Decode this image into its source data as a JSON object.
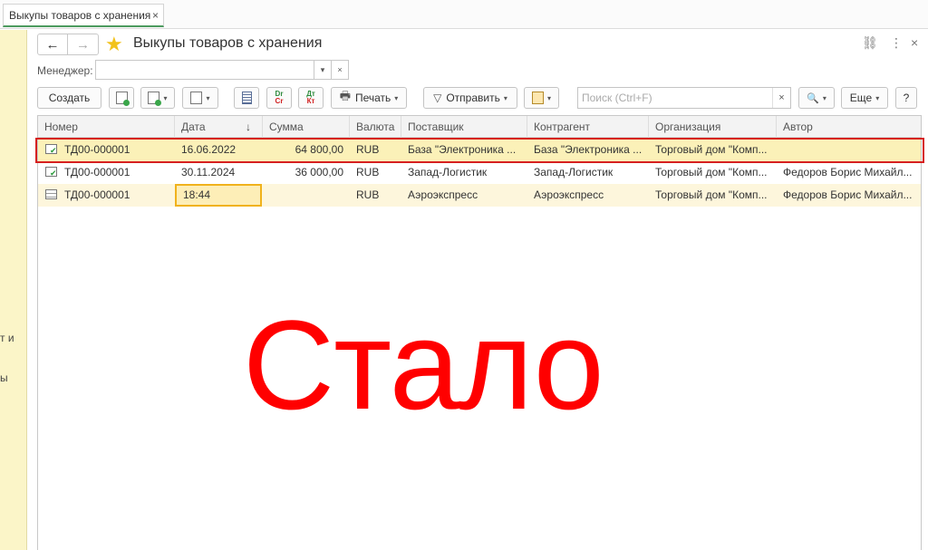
{
  "tab": {
    "label": "Выкупы товаров с хранения",
    "close": "×"
  },
  "left_panel": {
    "lines": [
      "т и",
      "ы"
    ]
  },
  "header": {
    "title": "Выкупы товаров с хранения",
    "back": "←",
    "forward": "→",
    "favorite": "★",
    "link_icon": "⛓",
    "more_icon": "⋮",
    "close_icon": "×"
  },
  "filter": {
    "label": "Менеджер:",
    "value": "",
    "dropdown": "▾",
    "clear": "×"
  },
  "toolbar": {
    "create_label": "Создать",
    "print_label": "Печать",
    "send_label": "Отправить",
    "more_label": "Еще",
    "help_label": "?",
    "search_placeholder": "Поиск (Ctrl+F)",
    "search_clear": "×",
    "search_icon": "🔍",
    "caret": "▾"
  },
  "table": {
    "columns": [
      "Номер",
      "Дата",
      "Сумма",
      "Валюта",
      "Поставщик",
      "Контрагент",
      "Организация",
      "Автор"
    ],
    "sort_indicator": "↓",
    "rows": [
      {
        "number": "ТД00-000001",
        "date": "16.06.2022",
        "sum": "64 800,00",
        "currency": "RUB",
        "supplier": "База \"Электроника ...",
        "counterparty": "База \"Электроника ...",
        "organization": "Торговый дом \"Комп...",
        "author": "",
        "status": "posted"
      },
      {
        "number": "ТД00-000001",
        "date": "30.11.2024",
        "sum": "36 000,00",
        "currency": "RUB",
        "supplier": "Запад-Логистик",
        "counterparty": "Запад-Логистик",
        "organization": "Торговый дом \"Комп...",
        "author": "Федоров Борис Михайл...",
        "status": "posted"
      },
      {
        "number": "ТД00-000001",
        "date": "18:44",
        "sum": "",
        "currency": "RUB",
        "supplier": "Аэроэкспресс",
        "counterparty": "Аэроэкспресс",
        "organization": "Торговый дом \"Комп...",
        "author": "Федоров Борис Михайл...",
        "status": "draft"
      }
    ]
  },
  "overlay_text": "Стало",
  "colors": {
    "accent_green": "#4d9b5f",
    "selection_red": "#d62020",
    "overlay_red": "#ff0000",
    "row_highlight": "#fbf1b8",
    "favorite_star": "#f2c21b"
  }
}
